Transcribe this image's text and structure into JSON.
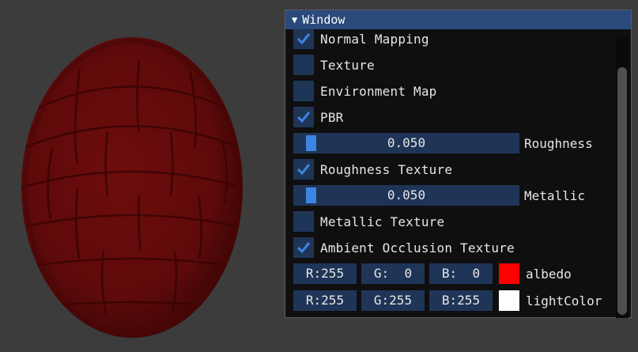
{
  "window": {
    "title": "Window",
    "collapse_icon": "triangle-down-icon"
  },
  "options": {
    "normal_mapping": {
      "label": "Normal Mapping",
      "checked": true
    },
    "texture": {
      "label": "Texture",
      "checked": false
    },
    "environment_map": {
      "label": "Environment Map",
      "checked": false
    },
    "pbr": {
      "label": "PBR",
      "checked": true
    },
    "roughness_texture": {
      "label": "Roughness Texture",
      "checked": true
    },
    "metallic_texture": {
      "label": "Metallic Texture",
      "checked": false
    },
    "ambient_occlusion_texture": {
      "label": "Ambient Occlusion Texture",
      "checked": true
    }
  },
  "sliders": {
    "roughness": {
      "label": "Roughness",
      "value": "0.050",
      "fraction": 0.05
    },
    "metallic": {
      "label": "Metallic",
      "value": "0.050",
      "fraction": 0.05
    }
  },
  "colors": {
    "albedo": {
      "label": "albedo",
      "r": "R:255",
      "g": "G:  0",
      "b": "B:  0",
      "swatch": "#ff0000"
    },
    "light_color": {
      "label": "lightColor",
      "r": "R:255",
      "g": "G:255",
      "b": "B:255",
      "swatch": "#ffffff"
    }
  },
  "theme": {
    "accent": "#3d85e0",
    "frame_bg": "#1f3557",
    "title_bg": "#294a7a",
    "object_color": "#6a0c0c"
  }
}
